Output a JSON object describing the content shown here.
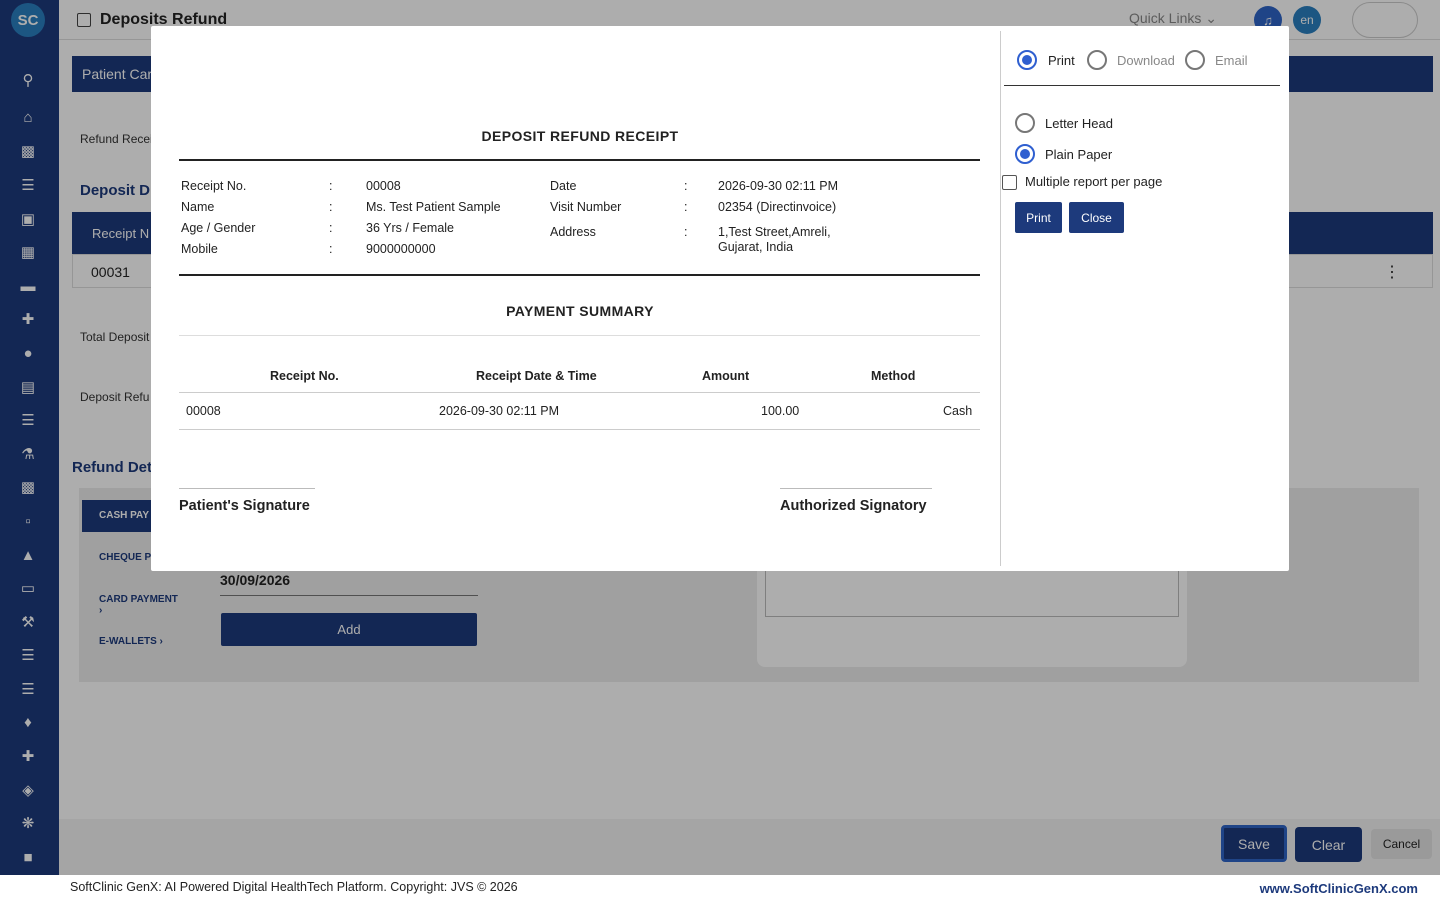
{
  "app": {
    "logo_text": "SC",
    "page_title": "Deposits Refund",
    "quick_links": "Quick Links ⌄",
    "language": "en"
  },
  "background": {
    "patient_card": "Patient Car",
    "refund_receipt_label": "Refund Recei",
    "deposit_details": "Deposit D",
    "receipt_col": "Receipt N",
    "row_receipt": "00031",
    "total_deposit": "Total Deposit",
    "deposit_refund": "Deposit Refu",
    "refund_details": "Refund Det",
    "tabs": [
      "CASH PAY",
      "CHEQUE P",
      "CARD PAYMENT ›",
      "E-WALLETS ›"
    ],
    "date_value": "30/09/2026",
    "add_label": "Add"
  },
  "footer": {
    "save": "Save",
    "clear": "Clear",
    "cancel": "Cancel",
    "copyright": "SoftClinic GenX: AI Powered Digital HealthTech Platform. Copyright: JVS © 2026",
    "website": "www.SoftClinicGenX.com"
  },
  "receipt": {
    "title": "DEPOSIT REFUND RECEIPT",
    "fields_left": [
      {
        "label": "Receipt No.",
        "value": "00008"
      },
      {
        "label": "Name",
        "value": "Ms. Test Patient Sample"
      },
      {
        "label": "Age / Gender",
        "value": "36 Yrs / Female"
      },
      {
        "label": "Mobile",
        "value": "9000000000"
      }
    ],
    "fields_right": [
      {
        "label": "Date",
        "value": "2026-09-30 02:11 PM"
      },
      {
        "label": "Visit Number",
        "value": "02354 (Directinvoice)"
      },
      {
        "label": "Address",
        "value": "1,Test Street,Amreli,",
        "value2": "Gujarat, India"
      }
    ],
    "colon": ":",
    "payment_summary_title": "PAYMENT SUMMARY",
    "table_headers": [
      "Receipt No.",
      "Receipt Date & Time",
      "Amount",
      "Method"
    ],
    "table_rows": [
      {
        "receipt_no": "00008",
        "datetime": "2026-09-30 02:11 PM",
        "amount": "100.00",
        "method": "Cash"
      }
    ],
    "patient_signature": "Patient's Signature",
    "authorized_signatory": "Authorized Signatory"
  },
  "print_panel": {
    "output_options": [
      {
        "label": "Print",
        "selected": true
      },
      {
        "label": "Download",
        "selected": false
      },
      {
        "label": "Email",
        "selected": false
      }
    ],
    "paper_options": [
      {
        "label": "Letter Head",
        "selected": false
      },
      {
        "label": "Plain Paper",
        "selected": true
      }
    ],
    "multiple_report": "Multiple report per page",
    "print_button": "Print",
    "close_button": "Close"
  }
}
